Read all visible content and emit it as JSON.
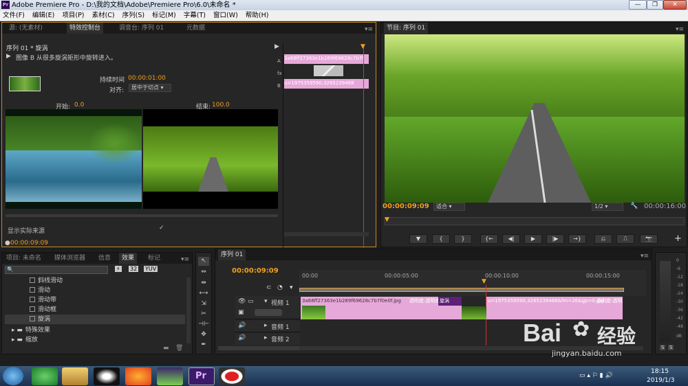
{
  "window": {
    "title": "Adobe Premiere Pro - D:\\我的文档\\Adobe\\Premiere Pro\\6.0\\未命名 *",
    "logo": "Pr",
    "min": "—",
    "max": "❐",
    "close": "✕"
  },
  "menu": [
    "文件(F)",
    "编辑(E)",
    "项目(P)",
    "素材(C)",
    "序列(S)",
    "标记(M)",
    "字幕(T)",
    "窗口(W)",
    "帮助(H)"
  ],
  "effect_controls": {
    "tabs": [
      "源: (无素材)",
      "特效控制台",
      "调音台: 序列 01",
      "元数据"
    ],
    "header": "序列 01 * 旋涡",
    "description": "图像 B 从很多旋涡矩形中旋转进入。",
    "duration_label": "持续时间",
    "duration_value": "00:00:01:00",
    "align_label": "对齐:",
    "align_value": "居中于切点",
    "start_label": "开始:",
    "start_value": "0.0",
    "end_label": "结束:",
    "end_value": "100.0",
    "show_source": "显示实际来源",
    "timecode": "00:00:09:09",
    "mini_clip_a": "3a68ff27363e1b289f69628c7b7f",
    "mini_clip_b": "u=1975359590,3265239468",
    "track_a": "A",
    "track_b": "B"
  },
  "program_monitor": {
    "tab": "节目: 序列 01",
    "timecode": "00:00:09:09",
    "fit": "适合",
    "quality": "1/2",
    "duration": "00:00:16:00",
    "transport": [
      "▼",
      "{",
      "}",
      "{←",
      "◀|",
      "▶",
      "|▶",
      "→}",
      "⎌",
      "⎍",
      "📷"
    ],
    "add": "+"
  },
  "project": {
    "tabs": [
      "项目: 未命名",
      "媒体浏览器",
      "信息",
      "效果",
      "标记"
    ],
    "badges": [
      "32",
      "YUV"
    ],
    "items": [
      "斜线滑动",
      "滑动",
      "滑动带",
      "滑动框",
      "旋涡"
    ],
    "folders": [
      "特殊效果",
      "缩放"
    ]
  },
  "tools": [
    "↖",
    "⇔",
    "⇹",
    "⟷",
    "⇲",
    "✂",
    "⊣⊢",
    "✥",
    "✒",
    "✋",
    "🔍"
  ],
  "timeline": {
    "tab": "序列 01",
    "timecode": "00:00:09:09",
    "ruler": [
      "00:00",
      "00:00:05:00",
      "00:00:10:00",
      "00:00:15:00"
    ],
    "tracks": [
      {
        "name": "视频 1"
      },
      {
        "name": "音频 1"
      },
      {
        "name": "音频 2"
      }
    ],
    "clip1_label": "3a68ff27363e1b289f69628c7b7f0e0f.jpg",
    "clip1_opacity": "透明度:透明度",
    "transition": "旋涡",
    "clip2_label": "u=1975359590,3265239468&fm=26&gp=0.jpg",
    "clip2_opacity": "透明度:透明度"
  },
  "audio_meter": {
    "labels": [
      "0",
      "-6",
      "-12",
      "-18",
      "-24",
      "-30",
      "-36",
      "-42",
      "-48",
      "dB"
    ],
    "solo": [
      "S",
      "S"
    ]
  },
  "watermark": {
    "brand": "Bai",
    "brand2": "经验",
    "url": "jingyan.baidu.com"
  },
  "taskbar": {
    "time": "18:15",
    "date": "2019/1/3"
  },
  "colors": {
    "accent": "#f0a020",
    "clip": "#e6a8d9",
    "transition": "#5d1f78"
  }
}
